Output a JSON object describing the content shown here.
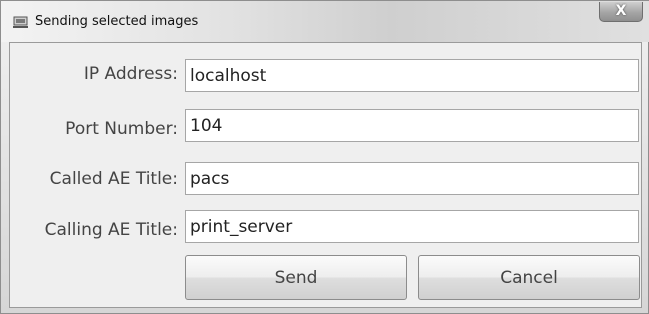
{
  "window": {
    "title": "Sending selected images",
    "close_label": "X"
  },
  "form": {
    "ip": {
      "label": "IP Address:",
      "value": "localhost"
    },
    "port": {
      "label": "Port Number:",
      "value": "104"
    },
    "called": {
      "label": "Called AE Title:",
      "value": "pacs"
    },
    "calling": {
      "label": "Calling AE Title:",
      "value": "print_server"
    }
  },
  "buttons": {
    "send_label": "Send",
    "cancel_label": "Cancel"
  }
}
